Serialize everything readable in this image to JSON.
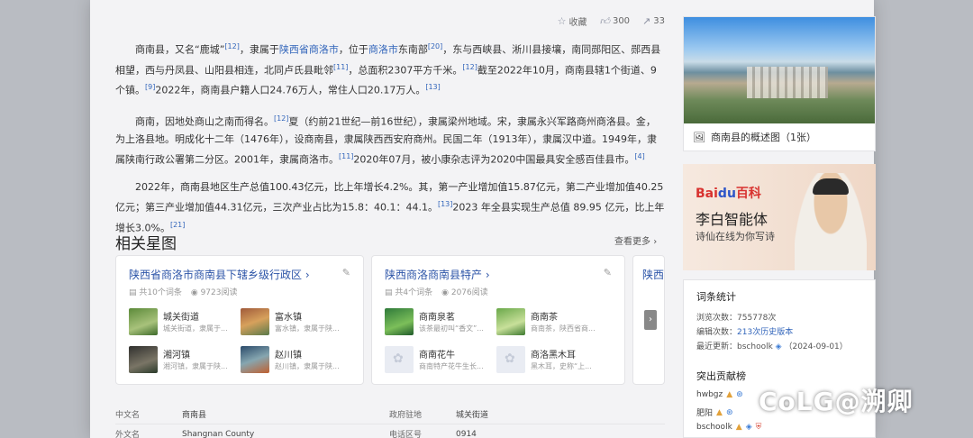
{
  "actions": {
    "favorite": "收藏",
    "like_count": "300",
    "share_count": "33"
  },
  "article": {
    "p1_parts": [
      "商南县，又名“鹿城”",
      "[12]",
      "，隶属于",
      "陕西省商洛市",
      "，位于",
      "商洛市",
      "东南部",
      "[20]",
      "，东与西峡县、淅川县接壤，南同郧阳区、郧西县相望，西与丹凤县、山阳县相连，北同卢氏县毗邻",
      "[11]",
      "，总面积2307平方千米。",
      "[12]",
      "截至2022年10月，商南县辖1个街道、9个镇。",
      "[9]",
      "2022年，商南县户籍人口24.76万人，常住人口20.17万人。",
      "[13]"
    ],
    "p2_parts": [
      "商南，因地处商山之南而得名。",
      "[12]",
      "夏（约前21世纪—前16世纪），隶属梁州地域。宋，隶属永兴军路商州商洛县。金，为上洛县地。明成化十二年（1476年），设商南县，隶属陕西西安府商州。民国二年（1913年），隶属汉中道。1949年，隶属陕南行政公署第二分区。2001年，隶属商洛市。",
      "[11]",
      "2020年07月，被小康杂志评为2020中国最具安全感百佳县市。",
      "[4]"
    ],
    "p3_parts": [
      "2022年，商南县地区生产总值100.43亿元，比上年增长4.2%。其，第一产业增加值15.87亿元，第二产业增加值40.25亿元；第三产业增加值44.31亿元，三次产业占比为15.8：40.1：44.1。",
      "[13]",
      "2023 年全县实现生产总值 89.95 亿元，比上年增长3.0%。",
      "[21]"
    ]
  },
  "related": {
    "title": "相关星图",
    "view_more": "查看更多",
    "cards": [
      {
        "title": "陕西省商洛市商南县下辖乡级行政区",
        "count": "共10个词条",
        "reads": "9723阅读",
        "items": [
          {
            "name": "城关街道",
            "desc": "城关街道，隶属于..."
          },
          {
            "name": "富水镇",
            "desc": "富水镇，隶属于陕..."
          },
          {
            "name": "湘河镇",
            "desc": "湘河镇，隶属于陕..."
          },
          {
            "name": "赵川镇",
            "desc": "赵川镇，隶属于陕..."
          }
        ]
      },
      {
        "title": "陕西商洛商南县特产",
        "count": "共4个词条",
        "reads": "2076阅读",
        "items": [
          {
            "name": "商南泉茗",
            "desc": "该茶最初叫“香文”..."
          },
          {
            "name": "商南茶",
            "desc": "商南茶，陕西省商..."
          },
          {
            "name": "商南花牛",
            "desc": "商南特产花牛生长..."
          },
          {
            "name": "商洛黑木耳",
            "desc": "黑木耳，史称“上..."
          }
        ]
      },
      {
        "title": "陕西"
      }
    ]
  },
  "infobox": {
    "rows": [
      {
        "k": "中文名",
        "v": "商南县",
        "k2": "政府驻地",
        "v2": "城关街道"
      },
      {
        "k": "外文名",
        "v": "Shangnan County",
        "k2": "电话区号",
        "v2": "0914"
      }
    ]
  },
  "sidebar": {
    "hero_caption": "商南县的概述图（1张）",
    "ad": {
      "brand_left": "Bai",
      "brand_mid": "du",
      "brand_right": "百科",
      "title": "李白智能体",
      "subtitle": "诗仙在线为你写诗"
    },
    "stats": {
      "title": "词条统计",
      "views_label": "浏览次数：",
      "views": "755778次",
      "edits_label": "编辑次数：",
      "edits": "213次历史版本",
      "updated_label": "最近更新：",
      "updated_user": "bschoolk",
      "updated_date": "（2024-09-01）"
    },
    "contributors_title": "突出贡献榜",
    "contributors": [
      "hwbgz",
      "肥阳",
      "bschoolk"
    ]
  },
  "watermark": "CoLG@溯卿"
}
